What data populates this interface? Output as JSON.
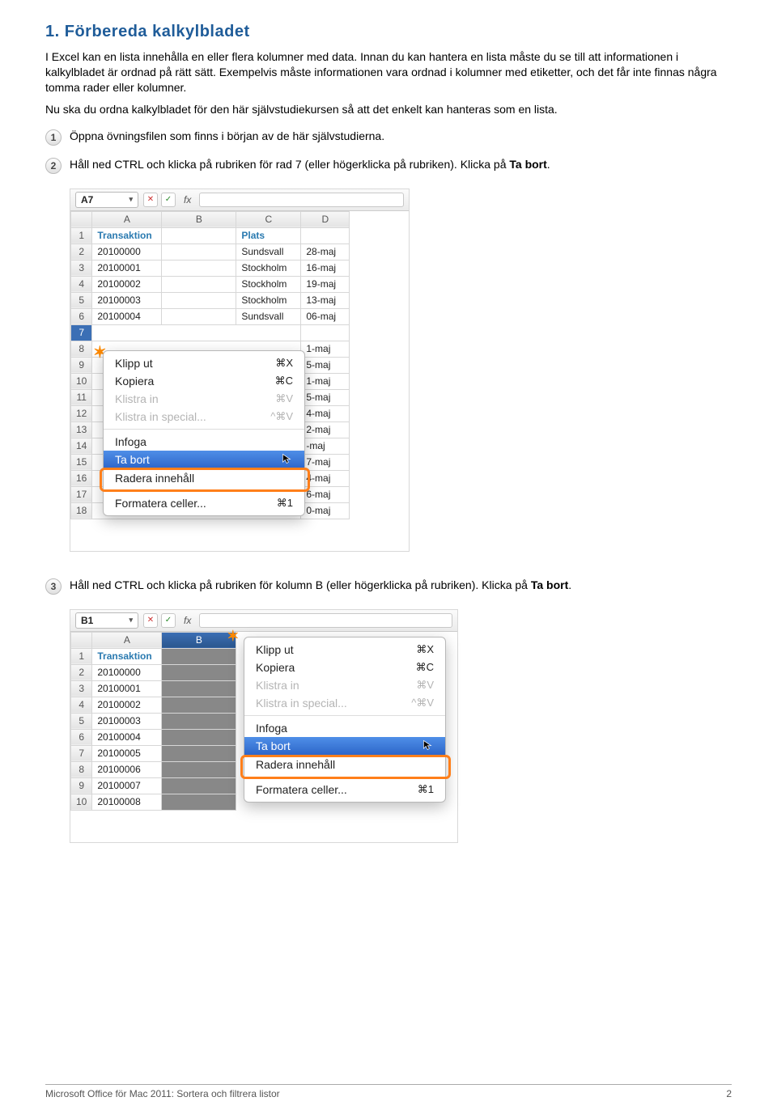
{
  "heading": "1. Förbereda kalkylbladet",
  "intro": [
    "I Excel kan en lista innehålla en eller flera kolumner med data. Innan du kan hantera en lista måste du se till att informationen i kalkylbladet är ordnad på rätt sätt. Exempelvis måste informationen vara ordnad i kolumner med etiketter, och det får inte finnas några tomma rader eller kolumner.",
    "Nu ska du ordna kalkylbladet för den här självstudiekursen så att det enkelt kan hanteras som en lista."
  ],
  "steps": {
    "s1": {
      "n": "1",
      "text": "Öppna övningsfilen som finns i början av de här självstudierna."
    },
    "s2": {
      "n": "2",
      "pre": "Håll ned CTRL och klicka på rubriken för rad 7 (eller högerklicka på rubriken). Klicka på ",
      "bold": "Ta bort",
      "post": "."
    },
    "s3": {
      "n": "3",
      "pre": "Håll ned CTRL och klicka på rubriken för kolumn B (eller högerklicka på rubriken). Klicka på ",
      "bold": "Ta bort",
      "post": "."
    }
  },
  "fx": {
    "cancel": "✕",
    "confirm": "✓",
    "fx": "fx"
  },
  "shortcuts": {
    "cut": "⌘X",
    "copy": "⌘C",
    "paste": "⌘V",
    "pasteSpecial": "^⌘V",
    "format": "⌘1"
  },
  "menu": {
    "cut": "Klipp ut",
    "copy": "Kopiera",
    "paste": "Klistra in",
    "pasteSpecial": "Klistra in special...",
    "insert": "Infoga",
    "delete": "Ta bort",
    "clear": "Radera innehåll",
    "format": "Formatera celler..."
  },
  "shot1": {
    "namebox": "A7",
    "cols": [
      "A",
      "B",
      "C",
      "D"
    ],
    "header": {
      "A": "Transaktion",
      "C": "Plats"
    },
    "rows": [
      {
        "r": "1",
        "A": "",
        "C": "",
        "D": ""
      },
      {
        "r": "2",
        "A": "20100000",
        "C": "Sundsvall",
        "D": "28-maj"
      },
      {
        "r": "3",
        "A": "20100001",
        "C": "Stockholm",
        "D": "16-maj"
      },
      {
        "r": "4",
        "A": "20100002",
        "C": "Stockholm",
        "D": "19-maj"
      },
      {
        "r": "5",
        "A": "20100003",
        "C": "Stockholm",
        "D": "13-maj"
      },
      {
        "r": "6",
        "A": "20100004",
        "C": "Sundsvall",
        "D": "06-maj"
      }
    ],
    "rowsAfter": [
      {
        "r": "7",
        "D": ""
      },
      {
        "r": "8",
        "D": "1-maj"
      },
      {
        "r": "9",
        "D": "5-maj"
      },
      {
        "r": "10",
        "D": "1-maj"
      },
      {
        "r": "11",
        "D": "5-maj"
      },
      {
        "r": "12",
        "D": "4-maj"
      },
      {
        "r": "13",
        "D": "2-maj"
      },
      {
        "r": "14",
        "D": "-maj"
      },
      {
        "r": "15",
        "D": "7-maj"
      },
      {
        "r": "16",
        "D": "4-maj"
      },
      {
        "r": "17",
        "D": "6-maj"
      },
      {
        "r": "18",
        "D": "0-maj"
      }
    ]
  },
  "shot2": {
    "namebox": "B1",
    "cols": [
      "A",
      "B"
    ],
    "header": {
      "A": "Transaktion"
    },
    "rows": [
      {
        "r": "1",
        "A": ""
      },
      {
        "r": "2",
        "A": "20100000"
      },
      {
        "r": "3",
        "A": "20100001"
      },
      {
        "r": "4",
        "A": "20100002"
      },
      {
        "r": "5",
        "A": "20100003"
      },
      {
        "r": "6",
        "A": "20100004"
      },
      {
        "r": "7",
        "A": "20100005"
      },
      {
        "r": "8",
        "A": "20100006"
      },
      {
        "r": "9",
        "A": "20100007"
      },
      {
        "r": "10",
        "A": "20100008"
      }
    ]
  },
  "footer": {
    "left": "Microsoft Office för Mac 2011: Sortera och filtrera listor",
    "right": "2"
  }
}
